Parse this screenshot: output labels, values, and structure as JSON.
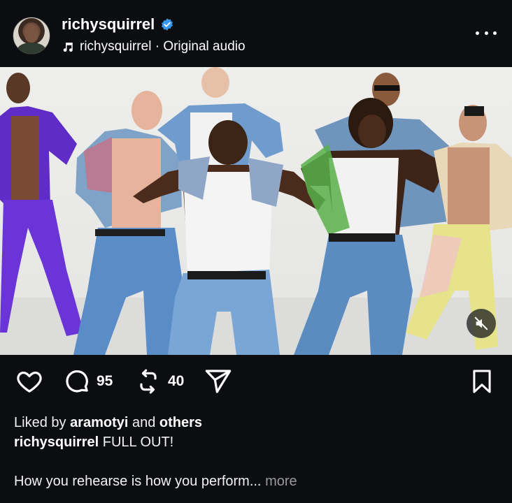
{
  "header": {
    "username": "richysquirrel",
    "audio_user": "richysquirrel",
    "audio_separator": " · ",
    "audio_label": "Original audio"
  },
  "actions": {
    "comments_count": "95",
    "reposts_count": "40"
  },
  "liked_by": {
    "prefix": "Liked by ",
    "user": "aramotyi",
    "middle": " and ",
    "others": "others"
  },
  "caption": {
    "author": "richysquirrel",
    "text": " FULL OUT!",
    "body": "How you rehearse is how you perform...",
    "more": "more"
  },
  "colors": {
    "background": "#0b0d10",
    "verified": "#3897f0",
    "more_link": "#9a9a9a"
  },
  "icons": [
    "verified-icon",
    "music-note-icon",
    "more-options-icon",
    "mute-icon",
    "heart-icon",
    "comment-icon",
    "repost-icon",
    "share-icon",
    "bookmark-icon"
  ]
}
